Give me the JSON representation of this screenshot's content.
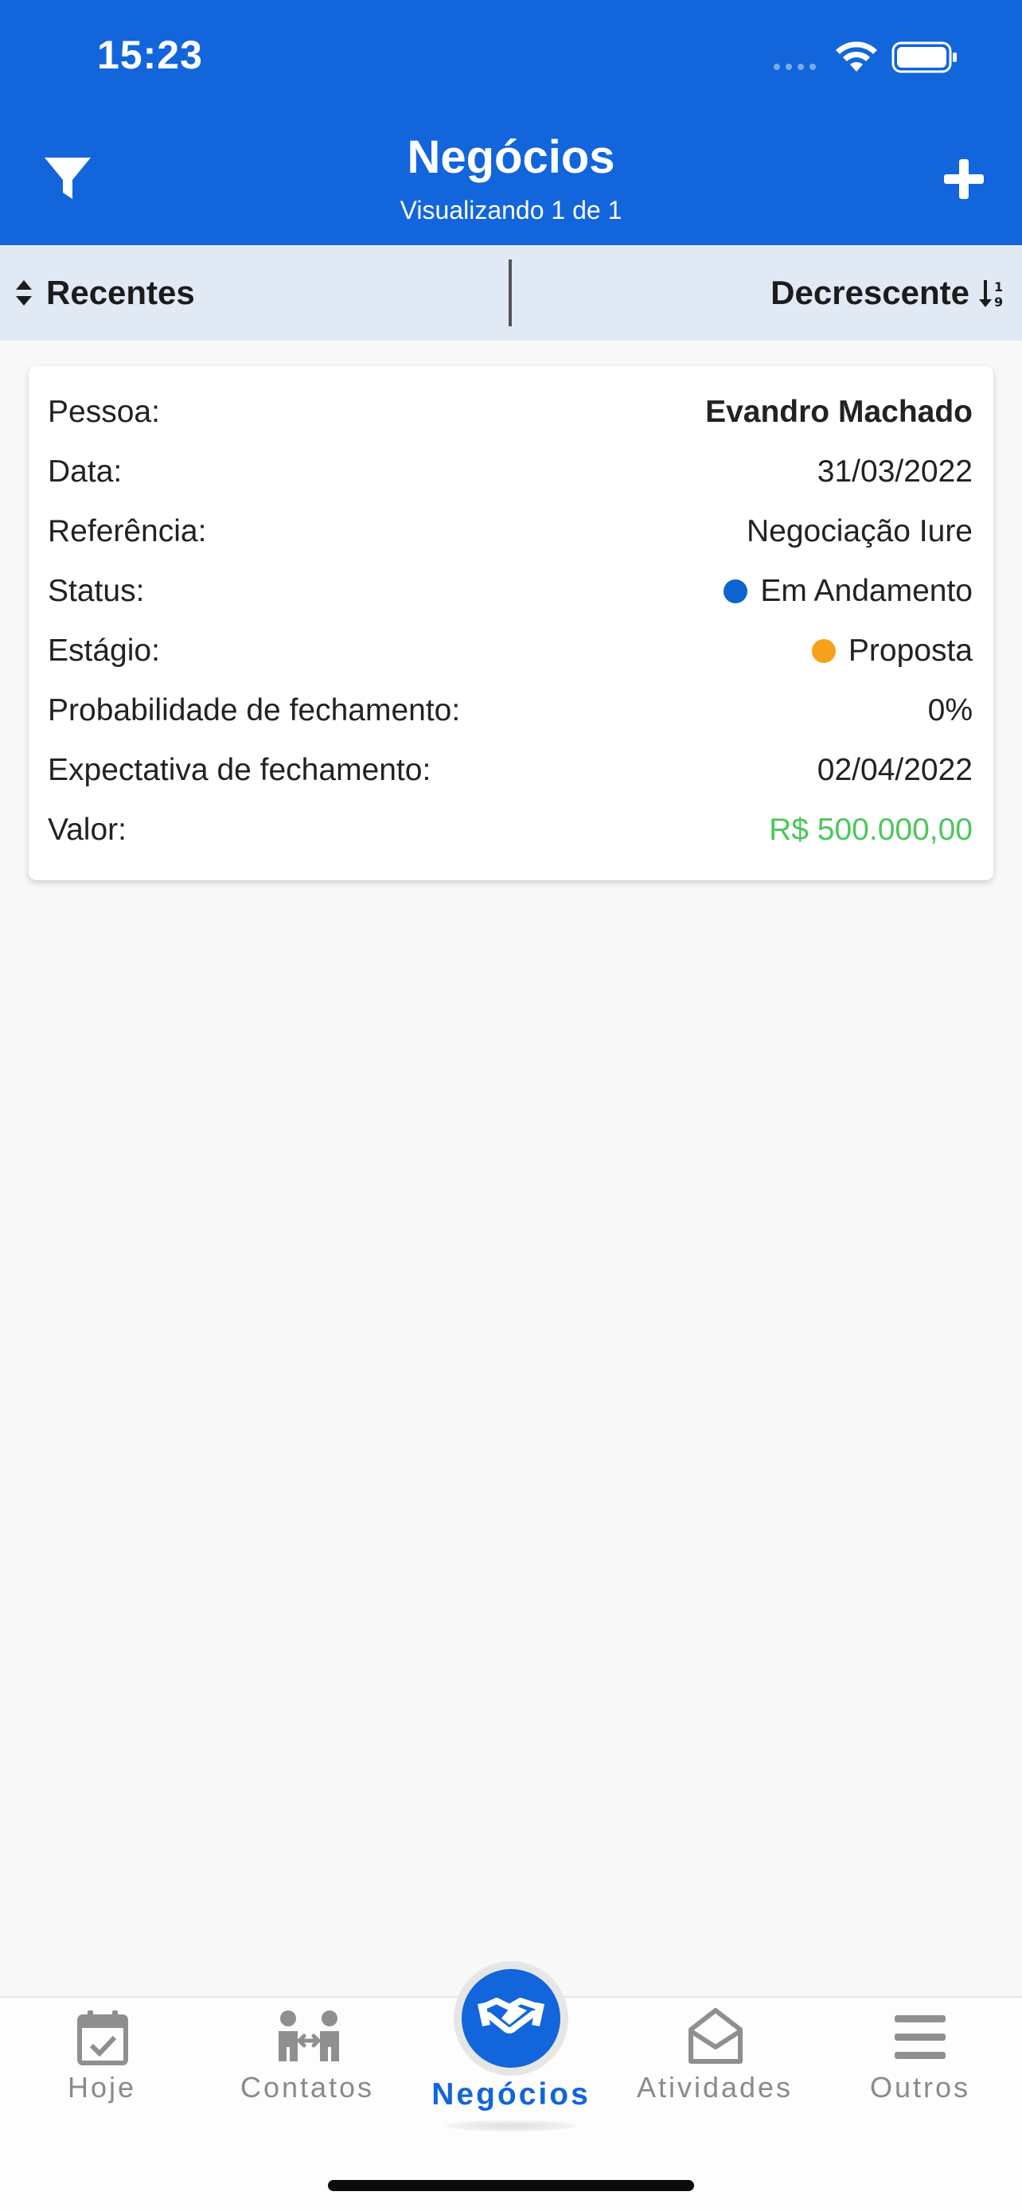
{
  "status_bar": {
    "time": "15:23"
  },
  "header": {
    "title": "Negócios",
    "subtitle": "Visualizando 1 de 1",
    "filter_icon": "filter-icon",
    "add_icon": "plus-icon"
  },
  "sort_bar": {
    "sort_by": "Recentes",
    "order": "Decrescente"
  },
  "deal": {
    "rows": [
      {
        "label": "Pessoa:",
        "value": "Evandro Machado"
      },
      {
        "label": "Data:",
        "value": "31/03/2022"
      },
      {
        "label": "Referência:",
        "value": "Negociação Iure"
      },
      {
        "label": "Status:",
        "value": "Em Andamento",
        "dot_color": "#0d63d1"
      },
      {
        "label": "Estágio:",
        "value": "Proposta",
        "dot_color": "#f5a11a"
      },
      {
        "label": "Probabilidade de fechamento:",
        "value": "0%"
      },
      {
        "label": "Expectativa de fechamento:",
        "value": "02/04/2022"
      },
      {
        "label": "Valor:",
        "value": "R$ 500.000,00",
        "value_color": "#4cc75a"
      }
    ]
  },
  "tabs": [
    {
      "label": "Hoje",
      "icon": "calendar-check-icon",
      "active": false
    },
    {
      "label": "Contatos",
      "icon": "contacts-people-icon",
      "active": false
    },
    {
      "label": "Negócios",
      "icon": "handshake-icon",
      "active": true
    },
    {
      "label": "Atividades",
      "icon": "envelope-open-icon",
      "active": false
    },
    {
      "label": "Outros",
      "icon": "menu-icon",
      "active": false
    }
  ],
  "colors": {
    "primary": "#1265db",
    "sortbar": "#e1e9f5",
    "money": "#4cc75a"
  }
}
